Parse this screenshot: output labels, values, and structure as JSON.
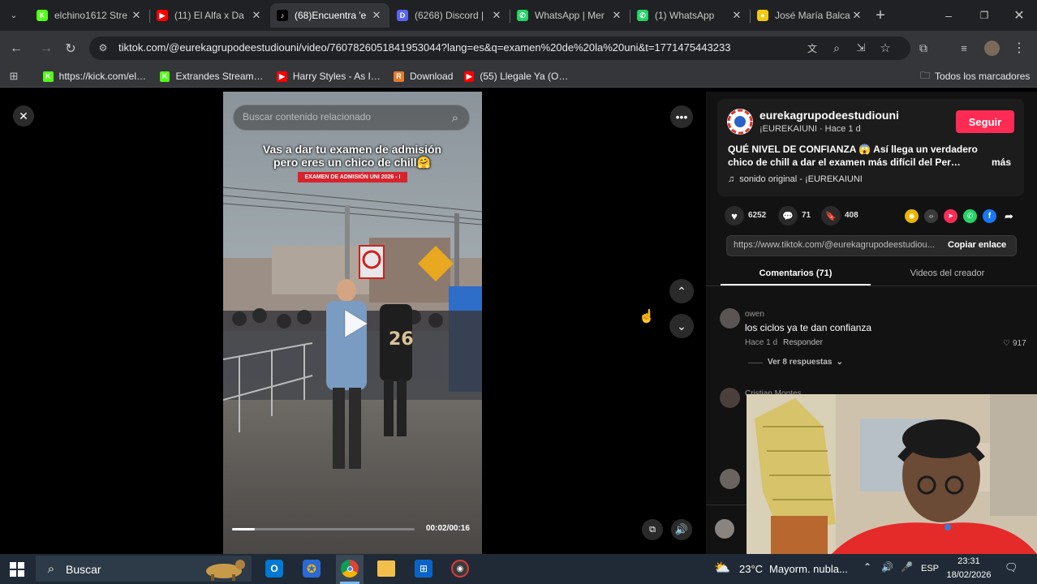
{
  "tabs": [
    {
      "title": "elchino1612 Stre",
      "icon": "kick-icon",
      "color": "#53fc18",
      "glyph": "K"
    },
    {
      "title": "(11) El Alfa x Da",
      "icon": "youtube-icon",
      "color": "#ff0000",
      "glyph": "▶"
    },
    {
      "title": "(68)Encuentra 'e",
      "icon": "tiktok-icon",
      "color": "#000000",
      "glyph": "♪"
    },
    {
      "title": "(6268) Discord |",
      "icon": "discord-icon",
      "color": "#5865f2",
      "glyph": "D"
    },
    {
      "title": "WhatsApp | Mer",
      "icon": "whatsapp-icon",
      "color": "#25d366",
      "glyph": "✆"
    },
    {
      "title": "(1) WhatsApp",
      "icon": "whatsapp-icon",
      "color": "#25d366",
      "glyph": "✆"
    },
    {
      "title": "José María Balca",
      "icon": "site-icon",
      "color": "#f2c811",
      "glyph": "●"
    }
  ],
  "url": "tiktok.com/@eurekagrupodeestudiouni/video/7607826051841953044?lang=es&q=examen%20de%20la%20uni&t=1771475443233",
  "bookmarks": [
    {
      "label": "https://kick.com/elc...",
      "icon": "kick-icon",
      "color": "#53fc18",
      "glyph": "K"
    },
    {
      "label": "Extrandes Stream -...",
      "icon": "kick-icon",
      "color": "#53fc18",
      "glyph": "K"
    },
    {
      "label": "Harry Styles - As It...",
      "icon": "youtube-icon",
      "color": "#ff0000",
      "glyph": "▶"
    },
    {
      "label": "Download",
      "icon": "download-site-icon",
      "color": "#e37b2b",
      "glyph": "R"
    },
    {
      "label": "(55) Llegale Ya (Offi...",
      "icon": "youtube-icon",
      "color": "#ff0000",
      "glyph": "▶"
    }
  ],
  "all_bookmarks": "Todos los marcadores",
  "video": {
    "search_placeholder": "Buscar contenido relacionado",
    "caption_line1": "Vas a dar tu examen de admisión",
    "caption_line2": "pero eres un chico de chill🤗",
    "banner": "EXAMEN DE ADMISIÓN UNI 2026 - I",
    "shirt_number": "26",
    "time": "00:02/00:16",
    "progress": 0.125
  },
  "creator": {
    "username": "eurekagrupodeestudiouni",
    "subtitle": "¡EUREKAIUNI · Hace 1 d",
    "follow": "Seguir",
    "description_line1": "QUÉ NIVEL DE CONFIANZA 😱 Así llega un verdadero",
    "description_line2": "chico de chill a dar el examen más difícil del Perú....",
    "more": "más",
    "sound": "sonido original - ¡EUREKAIUNI"
  },
  "stats": {
    "likes": "6252",
    "comments": "71",
    "saves": "408"
  },
  "link": {
    "url": "https://www.tiktok.com/@eurekagrupodeestudiou...",
    "copy": "Copiar enlace"
  },
  "panel_tabs": {
    "comments": "Comentarios (71)",
    "creator_videos": "Videos del creador"
  },
  "comment": {
    "author": "owen",
    "text": "los ciclos ya te dan confianza",
    "time": "Hace 1 d",
    "reply": "Responder",
    "likes": "917",
    "view_replies": "Ver 8 respuestas"
  },
  "comment2_author": "Cristian Montes",
  "taskbar": {
    "search": "Buscar",
    "weather_temp": "23°C",
    "weather_text": "Mayorm. nubla...",
    "lang": "ESP",
    "time": "23:31",
    "date": "18/02/2026"
  },
  "colors": {
    "tiktok_red": "#fe2c55",
    "chrome_dark": "#202124",
    "chrome_toolbar": "#35363a"
  }
}
